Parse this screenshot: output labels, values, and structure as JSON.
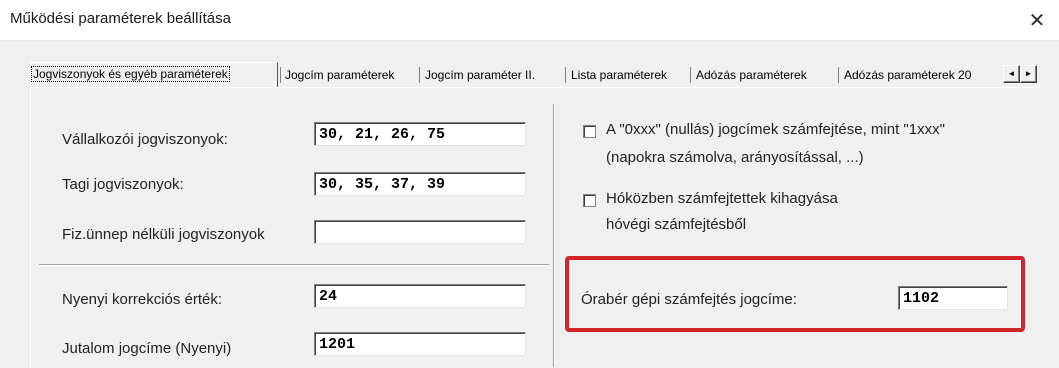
{
  "window": {
    "title": "Működési paraméterek beállítása",
    "close_glyph": "✕"
  },
  "tabs": [
    {
      "label": "Jogviszonyok és egyéb paraméterek",
      "active": true
    },
    {
      "label": "Jogcím paraméterek"
    },
    {
      "label": "Jogcím paraméter II."
    },
    {
      "label": "Lista paraméterek"
    },
    {
      "label": "Adózás paraméterek"
    },
    {
      "label": "Adózás paraméterek 20"
    }
  ],
  "tab_scroll": {
    "left": "◄",
    "right": "►"
  },
  "left": {
    "vallalkozoi": {
      "label": "Vállalkozói jogviszonyok:",
      "value": "30, 21, 26, 75"
    },
    "tagi": {
      "label": "Tagi jogviszonyok:",
      "value": "30, 35, 37, 39"
    },
    "fiz_unnep": {
      "label": "Fiz.ünnep nélküli jogviszonyok",
      "value": ""
    },
    "nyenyi_korr": {
      "label": "Nyenyi korrekciós érték:",
      "value": "24"
    },
    "jutalom": {
      "label": "Jutalom jogcíme (Nyenyi)",
      "value": "1201"
    }
  },
  "right": {
    "check1": {
      "line1": "A \"0xxx\" (nullás) jogcímek számfejtése, mint \"1xxx\"",
      "line2": "(napokra számolva, arányosítással, ...)",
      "checked": false
    },
    "check2": {
      "line1": "Hóközben számfejtettek kihagyása",
      "line2": "hóvégi számfejtésből",
      "checked": false
    },
    "oraber": {
      "label": "Órabér gépi számfejtés jogcíme:",
      "value": "1102"
    }
  },
  "colors": {
    "highlight": "#d0262b"
  }
}
